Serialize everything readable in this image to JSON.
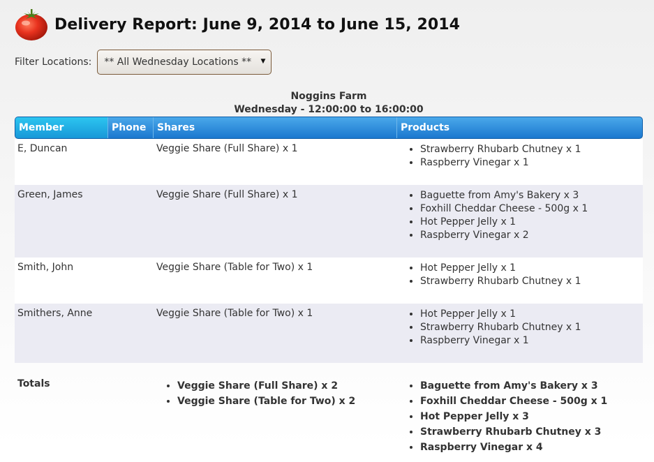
{
  "header": {
    "title": "Delivery Report: June 9, 2014 to June 15, 2014",
    "logo_icon": "tomato-icon"
  },
  "filter": {
    "label": "Filter Locations:",
    "selected": "** All Wednesday Locations **"
  },
  "location": {
    "name": "Noggins Farm",
    "schedule": "Wednesday - 12:00:00 to 16:00:00"
  },
  "table": {
    "columns": [
      "Member",
      "Phone",
      "Shares",
      "Products"
    ],
    "rows": [
      {
        "member": "E, Duncan",
        "phone": "",
        "shares": "Veggie Share (Full Share) x 1",
        "products": [
          "Strawberry Rhubarb Chutney x 1",
          "Raspberry Vinegar x 1"
        ]
      },
      {
        "member": "Green, James",
        "phone": "",
        "shares": "Veggie Share (Full Share) x 1",
        "products": [
          "Baguette from Amy's Bakery x 3",
          "Foxhill Cheddar Cheese - 500g x 1",
          "Hot Pepper Jelly x 1",
          "Raspberry Vinegar x 2"
        ]
      },
      {
        "member": "Smith, John",
        "phone": "",
        "shares": "Veggie Share (Table for Two) x 1",
        "products": [
          "Hot Pepper Jelly x 1",
          "Strawberry Rhubarb Chutney x 1"
        ]
      },
      {
        "member": "Smithers, Anne",
        "phone": "",
        "shares": "Veggie Share (Table for Two) x 1",
        "products": [
          "Hot Pepper Jelly x 1",
          "Strawberry Rhubarb Chutney x 1",
          "Raspberry Vinegar x 1"
        ]
      }
    ]
  },
  "totals": {
    "label": "Totals",
    "shares": [
      "Veggie Share (Full Share) x 2",
      "Veggie Share (Table for Two) x 2"
    ],
    "products": [
      "Baguette from Amy's Bakery x 3",
      "Foxhill Cheddar Cheese - 500g x 1",
      "Hot Pepper Jelly x 3",
      "Strawberry Rhubarb Chutney x 3",
      "Raspberry Vinegar x 4"
    ]
  },
  "colors": {
    "header_blue": "#1b78cf",
    "row_alt": "#ebebf3"
  }
}
